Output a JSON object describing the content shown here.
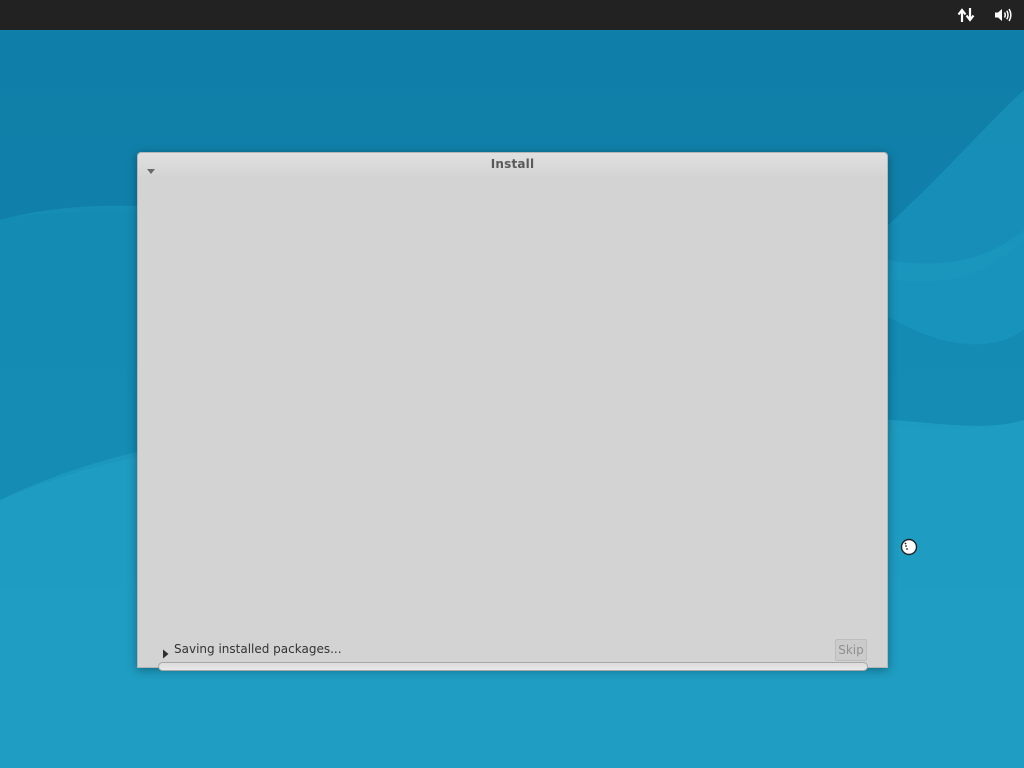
{
  "window": {
    "title": "Install"
  },
  "status": {
    "message": "Saving installed packages..."
  },
  "buttons": {
    "skip_label": "Skip"
  },
  "progress": {
    "fraction": 0
  },
  "icons": {
    "tray": [
      "network-updown-icon",
      "volume-icon"
    ],
    "window_menu": "menu-triangle-icon",
    "expander": "expander-right-icon",
    "cursor": "busy-cursor-icon"
  },
  "colors": {
    "topbar": "#222222",
    "desktop": "#1a92b8",
    "window_bg": "#d3d3d3",
    "title_text": "#5a5a5a",
    "status_text": "#333333",
    "disabled_button_text": "#909090"
  }
}
